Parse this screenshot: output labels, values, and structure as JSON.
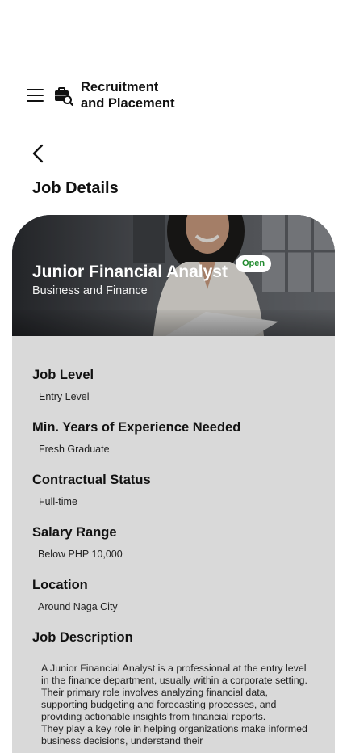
{
  "header": {
    "menu_icon": "hamburger-menu-icon",
    "brand_icon": "briefcase-search-icon",
    "title_line1": "Recruitment",
    "title_line2": "and Placement"
  },
  "nav": {
    "back_icon": "chevron-left-icon",
    "page_title": "Job Details"
  },
  "job": {
    "title": "Junior Financial Analyst",
    "category": "Business and Finance",
    "status": "Open",
    "status_color": "#1f8a2c",
    "card_color": "#d9d9d9",
    "fields": [
      {
        "label": "Job Level",
        "value": "Entry Level"
      },
      {
        "label": "Min. Years of Experience Needed",
        "value": "Fresh Graduate"
      },
      {
        "label": "Contractual Status",
        "value": "Full-time"
      },
      {
        "label": "Salary Range",
        "value": "Below PHP 10,000"
      },
      {
        "label": "Location",
        "value": "Around Naga City"
      }
    ],
    "description_label": "Job Description",
    "description_p1": "A Junior Financial Analyst is a professional at the entry level in the finance department, usually within a corporate setting. Their primary role involves analyzing financial data, supporting budgeting and forecasting processes, and providing actionable insights from financial reports.",
    "description_p2": "They play a key role in helping organizations make informed business decisions, understand their"
  }
}
